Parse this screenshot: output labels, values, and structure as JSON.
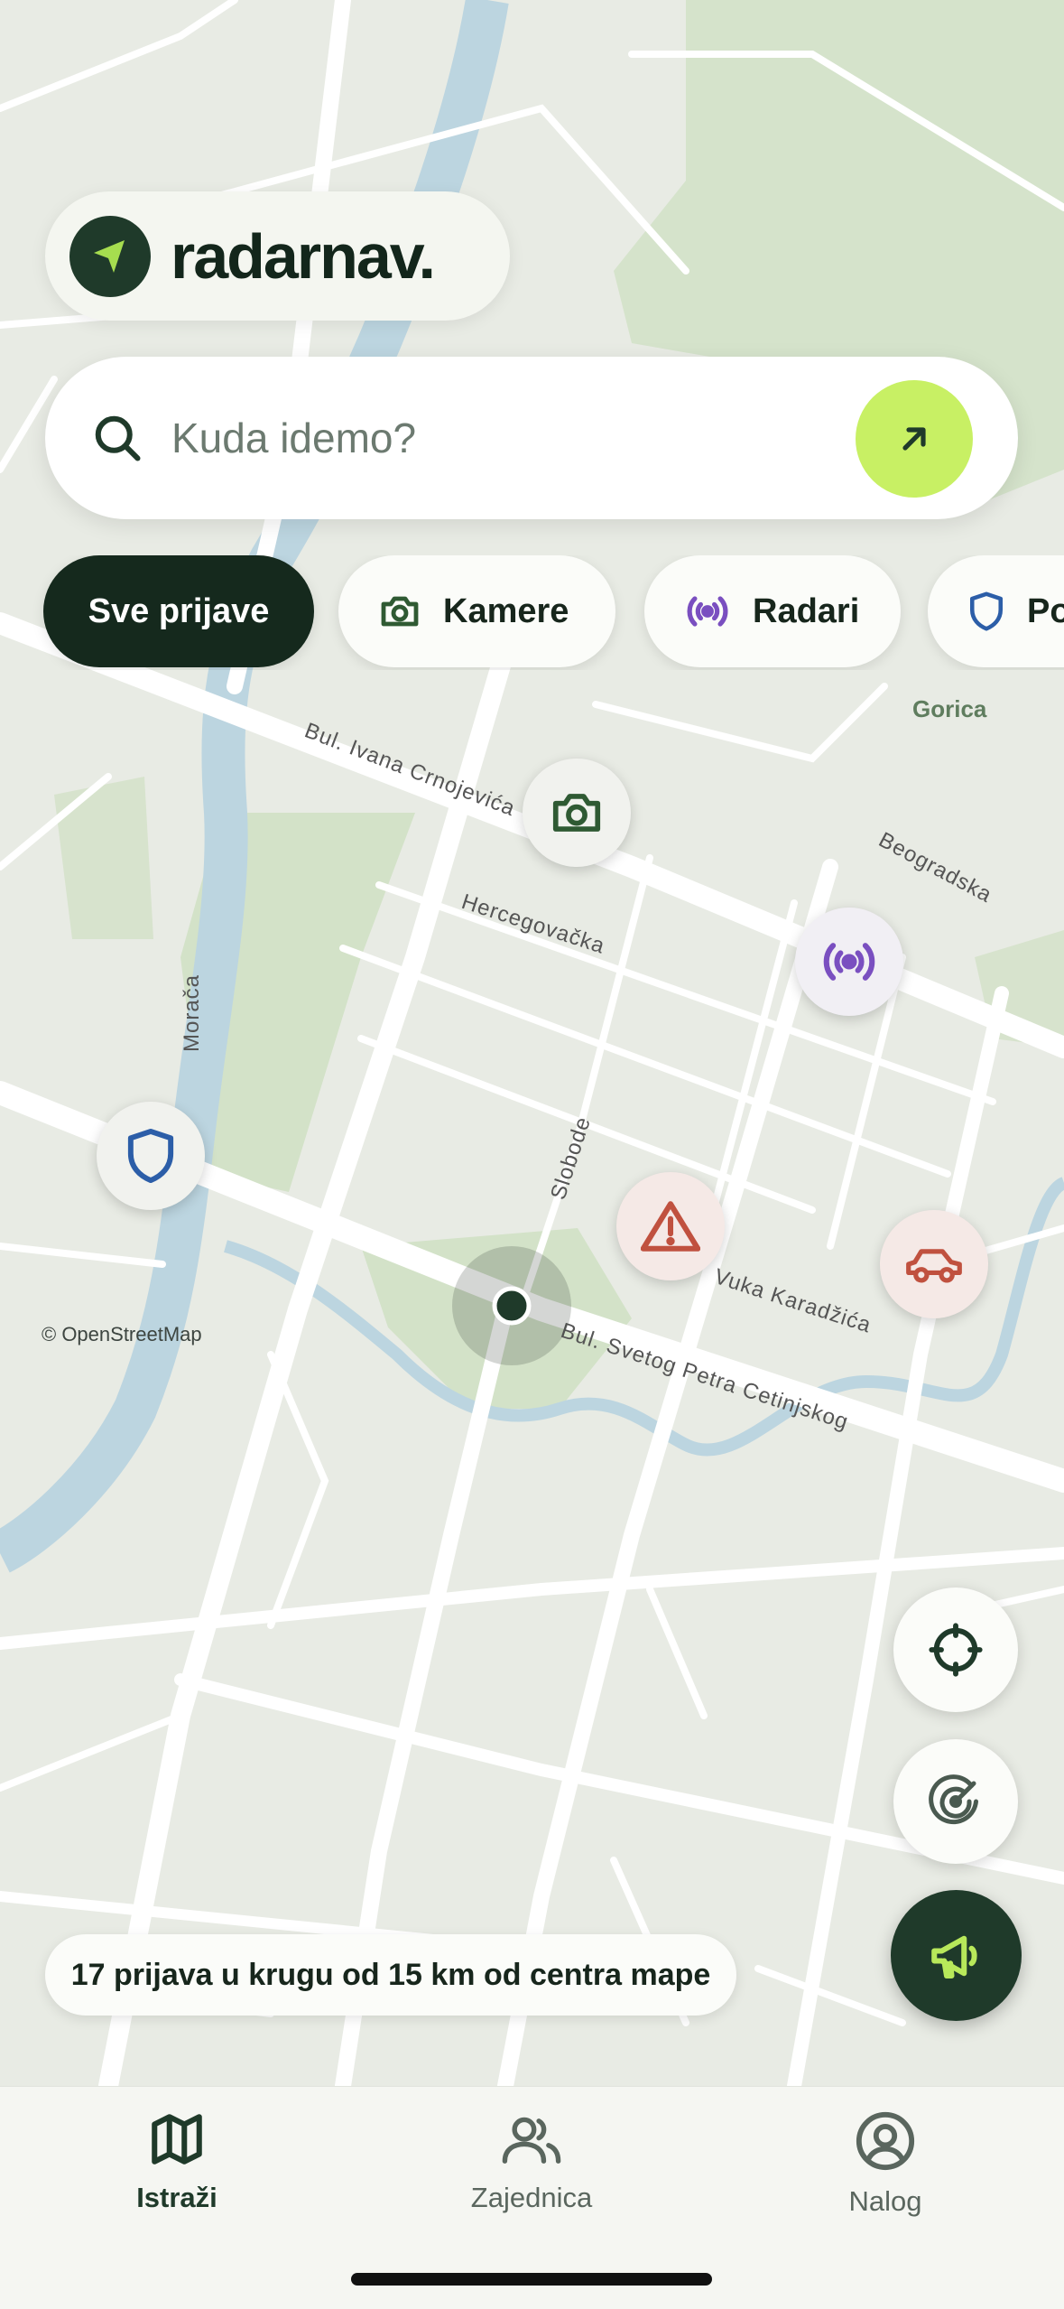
{
  "app": {
    "logo_text": "radarnav."
  },
  "search": {
    "placeholder": "Kuda idemo?"
  },
  "filters": [
    {
      "label": "Sve prijave",
      "active": true
    },
    {
      "label": "Kamere",
      "icon": "camera-icon"
    },
    {
      "label": "Radari",
      "icon": "radar-signal-icon"
    },
    {
      "label": "Policija",
      "icon": "shield-icon"
    }
  ],
  "map": {
    "streets": {
      "ivana_crnojevica": "Bul. Ivana Crnojevića",
      "hercegovacka": "Hercegovačka",
      "beogradska": "Beogradska",
      "moraca": "Morača",
      "slobode": "Slobode",
      "vuka_karadzica": "Vuka Karadžića",
      "svetog_petra": "Bul. Svetog Petra Cetinjskog"
    },
    "area_label": "Gorica",
    "attribution": "© OpenStreetMap",
    "colors": {
      "camera": "#2f5a33",
      "radar": "#7a4fc0",
      "police": "#2c5ea8",
      "hazard": "#c0513f"
    }
  },
  "status": {
    "text": "17 prijava u krugu od 15 km od centra mape"
  },
  "tabs": [
    {
      "label": "Istraži",
      "icon": "map-icon",
      "active": true
    },
    {
      "label": "Zajednica",
      "icon": "users-icon"
    },
    {
      "label": "Nalog",
      "icon": "user-circle-icon"
    }
  ],
  "theme": {
    "accent": "#c8f064",
    "dark": "#1f3a2a"
  }
}
